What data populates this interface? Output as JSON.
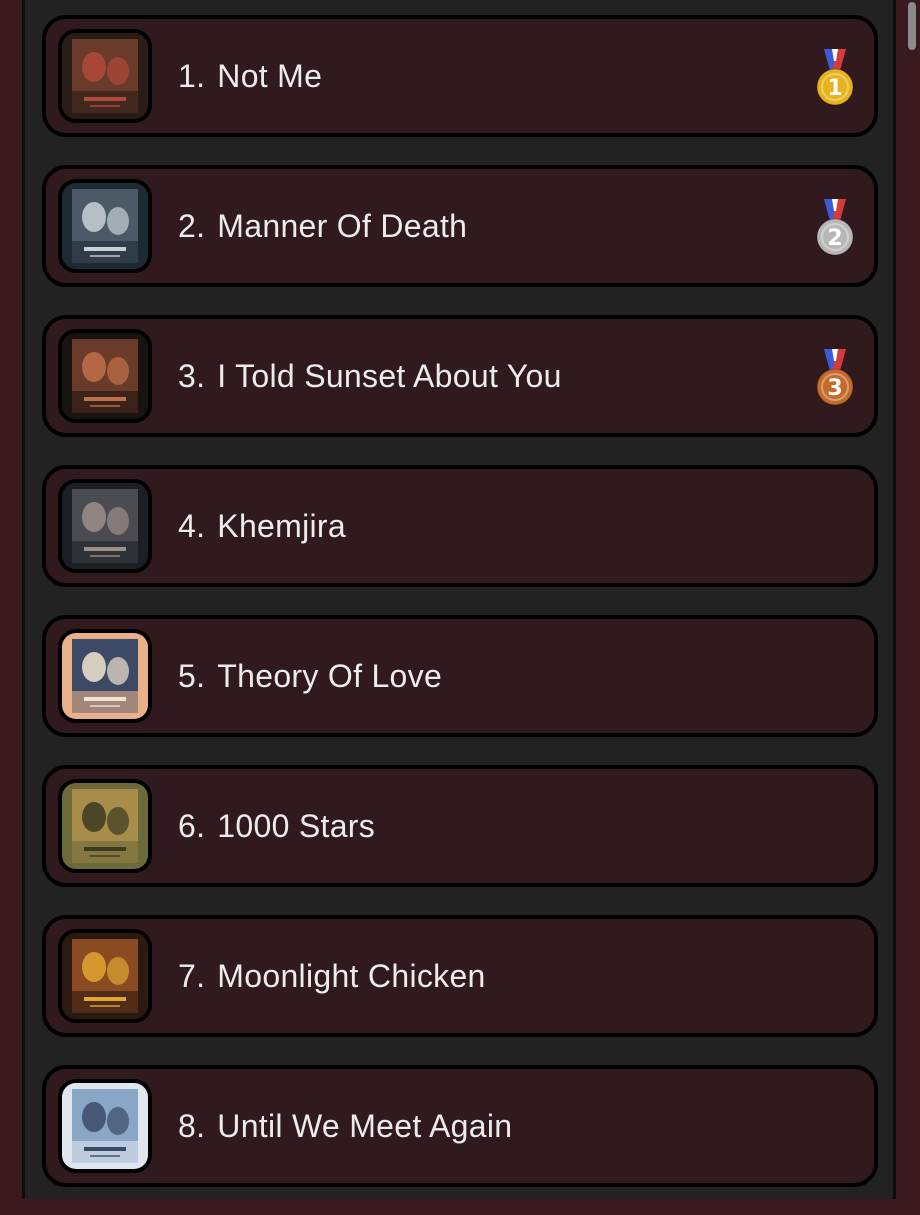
{
  "list": {
    "items": [
      {
        "rank": "1.",
        "title": "Not Me",
        "medal": "gold-medal-icon",
        "medal_number": "1",
        "medal_color": "#e8b21d",
        "poster_colors": [
          "#2a1d18",
          "#6a3a2a",
          "#b24a3a"
        ]
      },
      {
        "rank": "2.",
        "title": "Manner Of Death",
        "medal": "silver-medal-icon",
        "medal_number": "2",
        "medal_color": "#b7b7b7",
        "poster_colors": [
          "#1d2a33",
          "#4b5a66",
          "#c9d1d6"
        ]
      },
      {
        "rank": "3.",
        "title": "I Told Sunset About You",
        "medal": "bronze-medal-icon",
        "medal_number": "3",
        "medal_color": "#c46a2a",
        "poster_colors": [
          "#1a1410",
          "#6b3b2a",
          "#c0704a"
        ]
      },
      {
        "rank": "4.",
        "title": "Khemjira",
        "medal": null,
        "poster_colors": [
          "#1c2026",
          "#4a4c52",
          "#9c8f88"
        ]
      },
      {
        "rank": "5.",
        "title": "Theory Of Love",
        "medal": null,
        "poster_colors": [
          "#e9b08a",
          "#3d4a66",
          "#f1e3cf"
        ]
      },
      {
        "rank": "6.",
        "title": "1000 Stars",
        "medal": null,
        "poster_colors": [
          "#6c6a3a",
          "#a88c4a",
          "#3b3a22"
        ]
      },
      {
        "rank": "7.",
        "title": "Moonlight Chicken",
        "medal": null,
        "poster_colors": [
          "#2b1a12",
          "#8a4a22",
          "#e0a630"
        ]
      },
      {
        "rank": "8.",
        "title": "Until We Meet Again",
        "medal": null,
        "poster_colors": [
          "#dfe6ee",
          "#8aa6c6",
          "#3a4a66"
        ]
      }
    ]
  }
}
